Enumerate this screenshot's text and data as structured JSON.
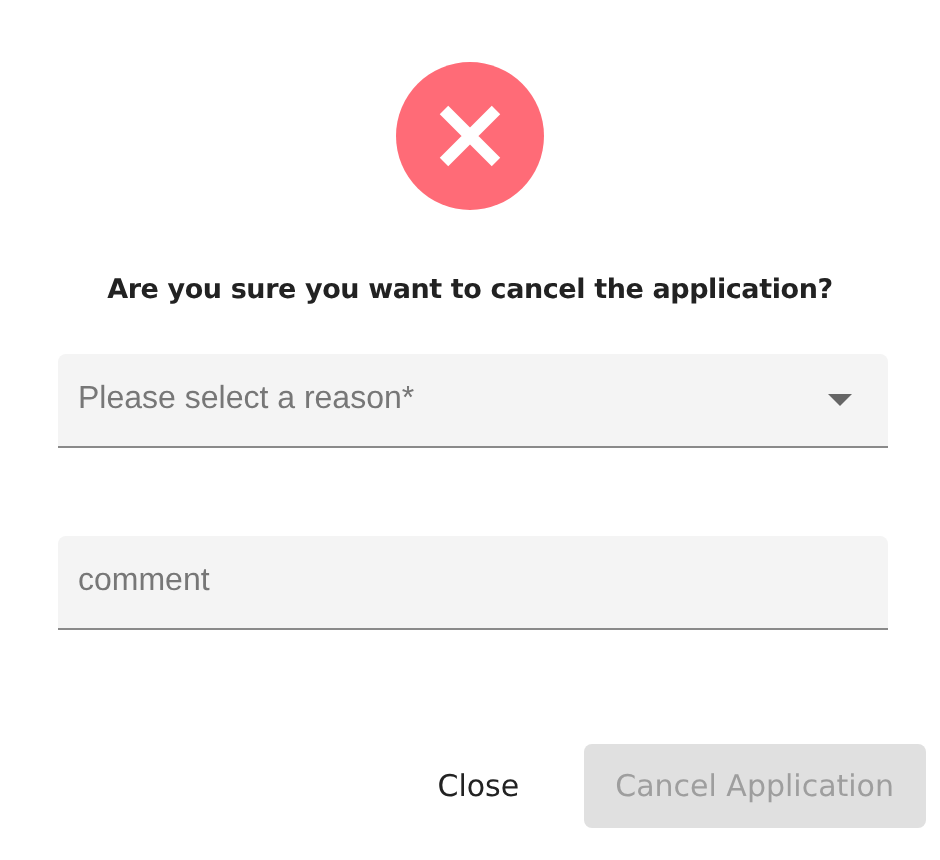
{
  "dialog": {
    "question": "Are you sure you want to cancel the application?",
    "reason_select": {
      "placeholder": "Please select a reason*"
    },
    "comment_field": {
      "placeholder": "comment"
    },
    "buttons": [
      {
        "label": "Close",
        "kind": "text",
        "disabled": false
      },
      {
        "label": "Cancel Application",
        "kind": "filled",
        "disabled": true
      }
    ]
  }
}
